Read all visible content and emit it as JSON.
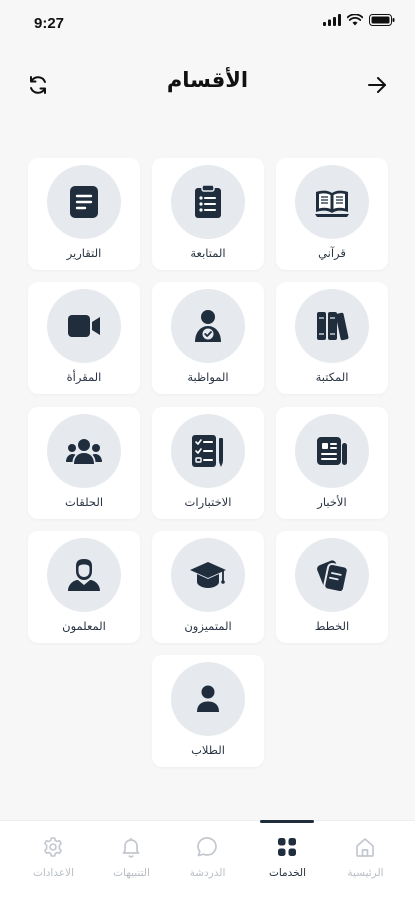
{
  "status_bar": {
    "time": "9:27"
  },
  "header": {
    "title": "الأقسام"
  },
  "sections": [
    {
      "label": "قرآني",
      "icon": "quran-book-icon"
    },
    {
      "label": "المتابعة",
      "icon": "clipboard-icon"
    },
    {
      "label": "التقارير",
      "icon": "document-icon"
    },
    {
      "label": "المكتبة",
      "icon": "books-icon"
    },
    {
      "label": "المواظبة",
      "icon": "person-badge-icon"
    },
    {
      "label": "المقرأة",
      "icon": "video-camera-icon"
    },
    {
      "label": "الأخبار",
      "icon": "newspaper-icon"
    },
    {
      "label": "الاختبارات",
      "icon": "checklist-icon"
    },
    {
      "label": "الحلقات",
      "icon": "group-icon"
    },
    {
      "label": "الخطط",
      "icon": "cards-icon"
    },
    {
      "label": "المتميزون",
      "icon": "graduation-cap-icon"
    },
    {
      "label": "المعلمون",
      "icon": "teacher-icon"
    },
    {
      "label": "الطلاب",
      "icon": "user-icon"
    }
  ],
  "bottom_nav": [
    {
      "label": "الرئيسية",
      "icon": "home-icon",
      "active": false
    },
    {
      "label": "الخدمات",
      "icon": "grid-icon",
      "active": true
    },
    {
      "label": "الدردشة",
      "icon": "chat-icon",
      "active": false
    },
    {
      "label": "التنبيهات",
      "icon": "bell-icon",
      "active": false
    },
    {
      "label": "الاعدادات",
      "icon": "gear-icon",
      "active": false
    }
  ],
  "colors": {
    "icon_dark": "#1f2d3d",
    "circle_bg": "#e6e9ee",
    "nav_inactive": "#b9bec6"
  }
}
